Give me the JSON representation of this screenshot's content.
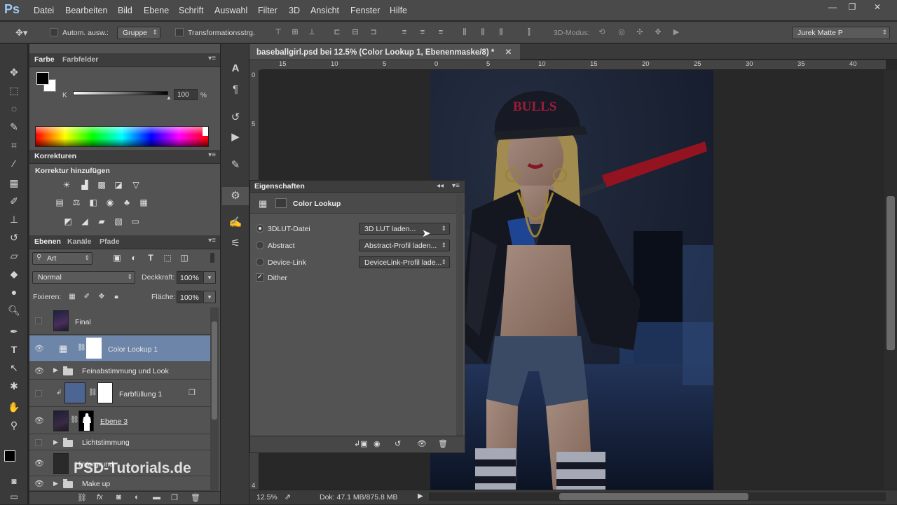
{
  "app": {
    "logo": "Ps"
  },
  "menubar": {
    "items": [
      "Datei",
      "Bearbeiten",
      "Bild",
      "Ebene",
      "Schrift",
      "Auswahl",
      "Filter",
      "3D",
      "Ansicht",
      "Fenster",
      "Hilfe"
    ]
  },
  "window_controls": {
    "minimize": "—",
    "restore": "❐",
    "close": "✕"
  },
  "options_bar": {
    "auto_select_label": "Autom. ausw.:",
    "auto_select_value": "Gruppe",
    "transform_label": "Transformationsstrg.",
    "mode_3d_label": "3D-Modus:",
    "workspace_value": "Jurek Matte P"
  },
  "color_panel": {
    "tabs": [
      "Farbe",
      "Farbfelder"
    ],
    "channel_label": "K",
    "channel_value": "100",
    "channel_unit": "%"
  },
  "adjustments_panel": {
    "tab": "Korrekturen",
    "heading": "Korrektur hinzufügen"
  },
  "layers_panel": {
    "tabs": [
      "Ebenen",
      "Kanäle",
      "Pfade"
    ],
    "filter_value": "Art",
    "blend_mode": "Normal",
    "opacity_label": "Deckkraft:",
    "opacity_value": "100%",
    "lock_label": "Fixieren:",
    "fill_label": "Fläche:",
    "fill_value": "100%",
    "layers": [
      {
        "name": "Final",
        "visible": false
      },
      {
        "name": "Color Lookup 1",
        "visible": true,
        "selected": true
      },
      {
        "name": "Feinabstimmung und Look",
        "visible": true
      },
      {
        "name": "Farbfüllung 1",
        "visible": false
      },
      {
        "name": "Ebene 3",
        "visible": true
      },
      {
        "name": "Lichtstimmung",
        "visible": false
      },
      {
        "name": "Hintergrund",
        "visible": true
      },
      {
        "name": "Make up",
        "visible": true
      }
    ]
  },
  "document": {
    "tab_title": "baseballgirl.psd bei 12.5% (Color Lookup 1, Ebenenmaske/8) *",
    "ruler_h": [
      "15",
      "10",
      "5",
      "0",
      "5",
      "10",
      "15",
      "20",
      "25",
      "30",
      "35",
      "40"
    ],
    "ruler_v": [
      "0",
      "5",
      "4"
    ]
  },
  "properties_panel": {
    "tab": "Eigenschaften",
    "title": "Color Lookup",
    "options": [
      {
        "label": "3DLUT-Datei",
        "value": "3D LUT laden...",
        "selected": true
      },
      {
        "label": "Abstract",
        "value": "Abstract-Profil laden...",
        "selected": false
      },
      {
        "label": "Device-Link",
        "value": "DeviceLink-Profil  lade...",
        "selected": false
      }
    ],
    "dither_label": "Dither",
    "dither_checked": true
  },
  "statusbar": {
    "zoom": "12.5%",
    "doc_info": "Dok: 47.1 MB/875.8 MB"
  },
  "watermark": {
    "text": "PSD-Tutorials.de"
  },
  "canvas_art": {
    "cap_text": "BULLS"
  }
}
